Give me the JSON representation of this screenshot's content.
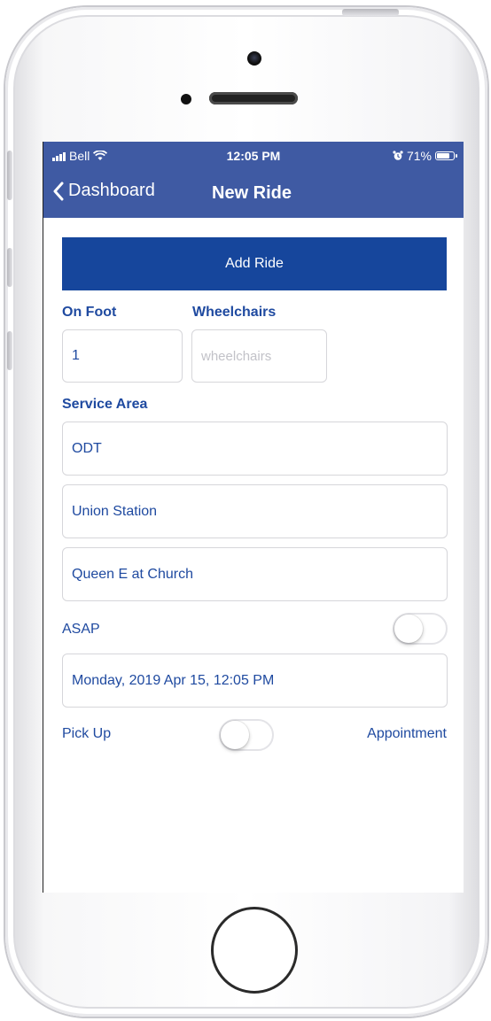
{
  "status_bar": {
    "carrier": "Bell",
    "time": "12:05 PM",
    "battery_percent": "71%",
    "battery_level": 0.71
  },
  "nav": {
    "back_label": "Dashboard",
    "title": "New Ride"
  },
  "form": {
    "add_ride_label": "Add Ride",
    "on_foot_label": "On Foot",
    "wheelchairs_label": "Wheelchairs",
    "on_foot_value": "1",
    "wheelchairs_placeholder": "wheelchairs",
    "service_area_label": "Service Area",
    "service_area_value": "ODT",
    "origin_value": "Union Station",
    "destination_value": "Queen E at Church",
    "asap_label": "ASAP",
    "asap_on": false,
    "datetime_value": "Monday, 2019 Apr 15, 12:05 PM",
    "pickup_label": "Pick Up",
    "appointment_label": "Appointment",
    "pickup_appointment_toggle_on": false
  },
  "colors": {
    "nav_blue": "#3f5aa3",
    "button_blue": "#16469c",
    "text_blue": "#1f4aa0"
  }
}
